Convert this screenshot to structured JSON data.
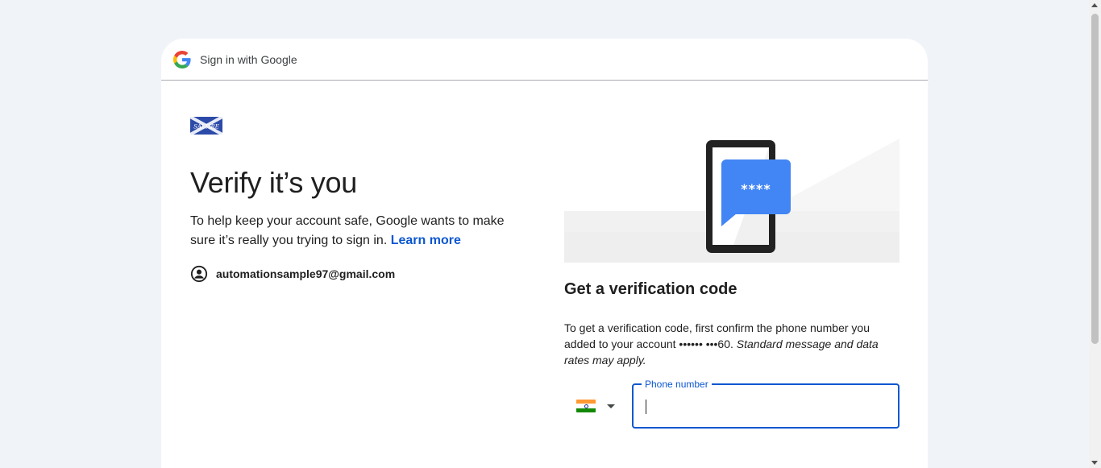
{
  "header": {
    "title": "Sign in with Google",
    "logo_icon": "google-g-icon"
  },
  "brand": {
    "logo_text": "SALTIRE"
  },
  "main": {
    "headline": "Verify it’s you",
    "description": "To help keep your account safe, Google wants to make sure it’s really you trying to sign in.",
    "learn_more": "Learn more",
    "account_email": "automationsample97@gmail.com",
    "account_icon": "account-circle-icon"
  },
  "verification": {
    "title": "Get a verification code",
    "instruction": "To get a verification code, first confirm the phone number you added to your account •••••• •••60.",
    "instruction_note": "Standard message and data rates may apply.",
    "code_mask": "****",
    "phone_field": {
      "label": "Phone number",
      "value": "",
      "country_flag": "india-flag-icon"
    }
  },
  "colors": {
    "accent": "#0b57d0",
    "page_bg": "#f0f4f9",
    "card_bg": "#ffffff",
    "bubble": "#4285f4"
  }
}
